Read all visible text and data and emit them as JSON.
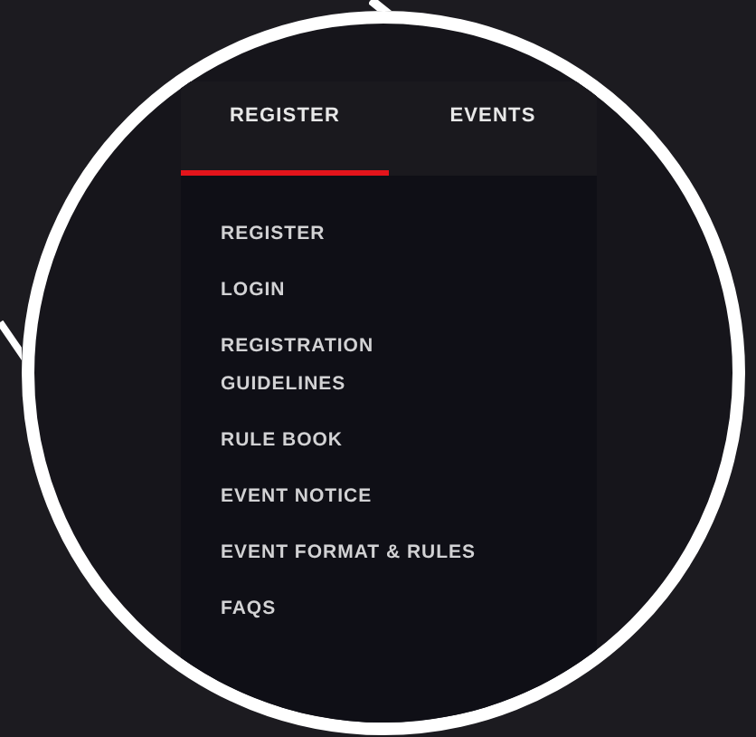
{
  "tabs": [
    {
      "label": "REGISTER",
      "selected": true
    },
    {
      "label": "EVENTS",
      "selected": false
    }
  ],
  "menu": {
    "items": [
      {
        "label": "REGISTER"
      },
      {
        "label": "LOGIN"
      },
      {
        "label": "REGISTRATION\nGUIDELINES"
      },
      {
        "label": "RULE BOOK"
      },
      {
        "label": "EVENT NOTICE"
      },
      {
        "label": "EVENT FORMAT & RULES"
      },
      {
        "label": "FAQS"
      }
    ]
  }
}
